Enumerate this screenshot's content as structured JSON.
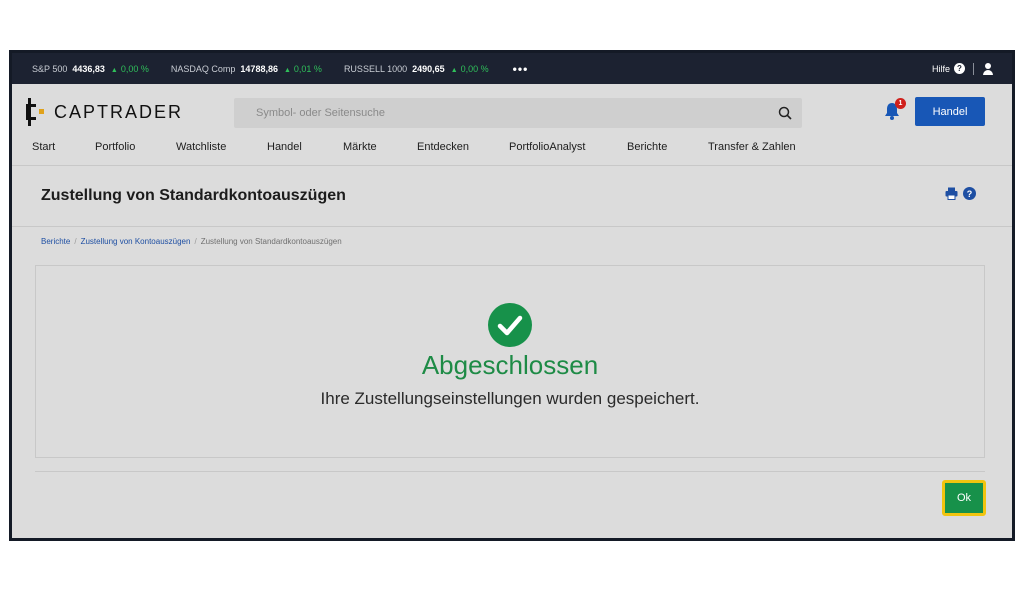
{
  "ticker": [
    {
      "name": "S&P 500",
      "value": "4436,83",
      "change": "0,00 %"
    },
    {
      "name": "NASDAQ Comp",
      "value": "14788,86",
      "change": "0,01 %"
    },
    {
      "name": "RUSSELL 1000",
      "value": "2490,65",
      "change": "0,00 %"
    }
  ],
  "ticker_more": "•••",
  "help_label": "Hilfe",
  "help_glyph": "?",
  "brand": "CAPTRADER",
  "search": {
    "placeholder": "Symbol- oder Seitensuche"
  },
  "notifications": {
    "count": "1"
  },
  "trade_button": "Handel",
  "nav": [
    "Start",
    "Portfolio",
    "Watchliste",
    "Handel",
    "Märkte",
    "Entdecken",
    "PortfolioAnalyst",
    "Berichte",
    "Transfer & Zahlen"
  ],
  "page_title": "Zustellung von Standardkontoauszügen",
  "breadcrumb": [
    "Berichte",
    "Zustellung von Kontoauszügen",
    "Zustellung von Standardkontoauszügen"
  ],
  "breadcrumb_sep": "/",
  "status": {
    "title": "Abgeschlossen",
    "message": "Ihre Zustellungseinstellungen wurden gespeichert."
  },
  "ok_button": "Ok",
  "colors": {
    "accent_green": "#17914a",
    "brand_blue": "#1857b6",
    "ticker_bg": "#1c2231",
    "focus_ring": "#f1c40f"
  },
  "icons": [
    "search-icon",
    "bell-icon",
    "user-icon",
    "print-icon",
    "help-icon",
    "check-icon"
  ]
}
